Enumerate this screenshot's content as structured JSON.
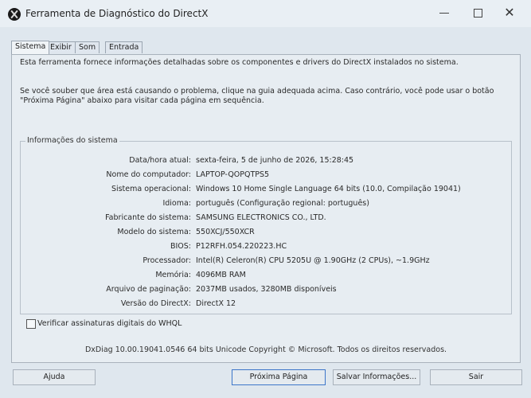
{
  "window": {
    "title": "Ferramenta de Diagnóstico do DirectX"
  },
  "tabs": [
    {
      "label": "Sistema",
      "active": true
    },
    {
      "label": "Exibir",
      "active": false
    },
    {
      "label": "Som",
      "active": false
    },
    {
      "label": "Entrada",
      "active": false
    }
  ],
  "intro": {
    "line1": "Esta ferramenta fornece informações detalhadas sobre os componentes e drivers do DirectX instalados no sistema.",
    "line2": "Se você souber que área está causando o problema, clique na guia adequada acima. Caso contrário, você pode usar o botão \"Próxima Página\" abaixo para visitar cada página em sequência."
  },
  "system_info": {
    "group_title": "Informações do sistema",
    "rows": [
      {
        "label": "Data/hora atual:",
        "value": "sexta-feira, 5 de junho de 2026, 15:28:45"
      },
      {
        "label": "Nome do computador:",
        "value": "LAPTOP-QOPQTPS5"
      },
      {
        "label": "Sistema operacional:",
        "value": "Windows 10 Home Single Language 64 bits (10.0, Compilação 19041)"
      },
      {
        "label": "Idioma:",
        "value": "português (Configuração regional: português)"
      },
      {
        "label": "Fabricante do sistema:",
        "value": "SAMSUNG ELECTRONICS CO., LTD."
      },
      {
        "label": "Modelo do sistema:",
        "value": "550XCJ/550XCR"
      },
      {
        "label": "BIOS:",
        "value": "P12RFH.054.220223.HC"
      },
      {
        "label": "Processador:",
        "value": "Intel(R) Celeron(R) CPU 5205U @ 1.90GHz (2 CPUs), ~1.9GHz"
      },
      {
        "label": "Memória:",
        "value": "4096MB RAM"
      },
      {
        "label": "Arquivo de paginação:",
        "value": "2037MB usados, 3280MB disponíveis"
      },
      {
        "label": "Versão do DirectX:",
        "value": "DirectX 12"
      }
    ]
  },
  "whql": {
    "label": "Verificar assinaturas digitais do WHQL",
    "checked": false
  },
  "copyright": "DxDiag 10.00.19041.0546 64 bits Unicode  Copyright © Microsoft. Todos os direitos reservados.",
  "buttons": {
    "help": "Ajuda",
    "next": "Próxima Página",
    "save": "Salvar Informações...",
    "exit": "Sair"
  }
}
